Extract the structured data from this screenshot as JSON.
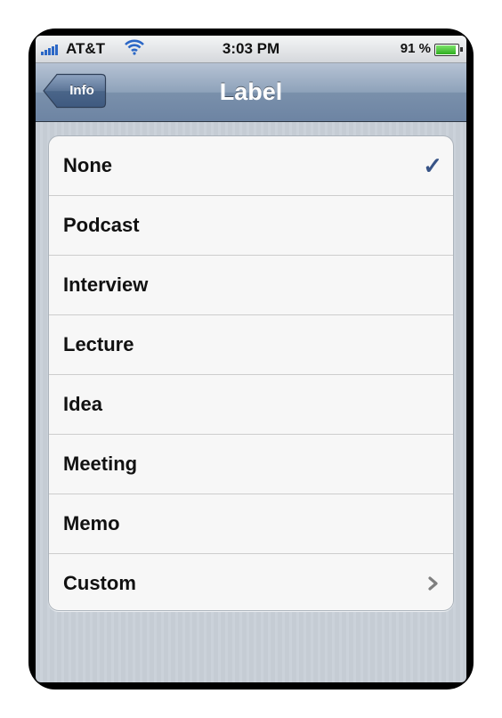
{
  "status_bar": {
    "carrier": "AT&T",
    "time": "3:03 PM",
    "battery_percent_text": "91 %",
    "battery_level": 0.91,
    "signal_icon": "signal-bars-icon",
    "wifi_icon": "wifi-icon",
    "battery_icon": "battery-icon"
  },
  "nav_bar": {
    "back_label": "Info",
    "title": "Label"
  },
  "list": {
    "items": [
      {
        "label": "None",
        "accessory": "checkmark"
      },
      {
        "label": "Podcast",
        "accessory": ""
      },
      {
        "label": "Interview",
        "accessory": ""
      },
      {
        "label": "Lecture",
        "accessory": ""
      },
      {
        "label": "Idea",
        "accessory": ""
      },
      {
        "label": "Meeting",
        "accessory": ""
      },
      {
        "label": "Memo",
        "accessory": ""
      },
      {
        "label": "Custom",
        "accessory": "disclosure-chevron"
      }
    ],
    "checkmark_glyph": "✓"
  },
  "colors": {
    "checkmark": "#385487",
    "nav_bar": "#6d84a3",
    "background": "#c5ccd4"
  }
}
